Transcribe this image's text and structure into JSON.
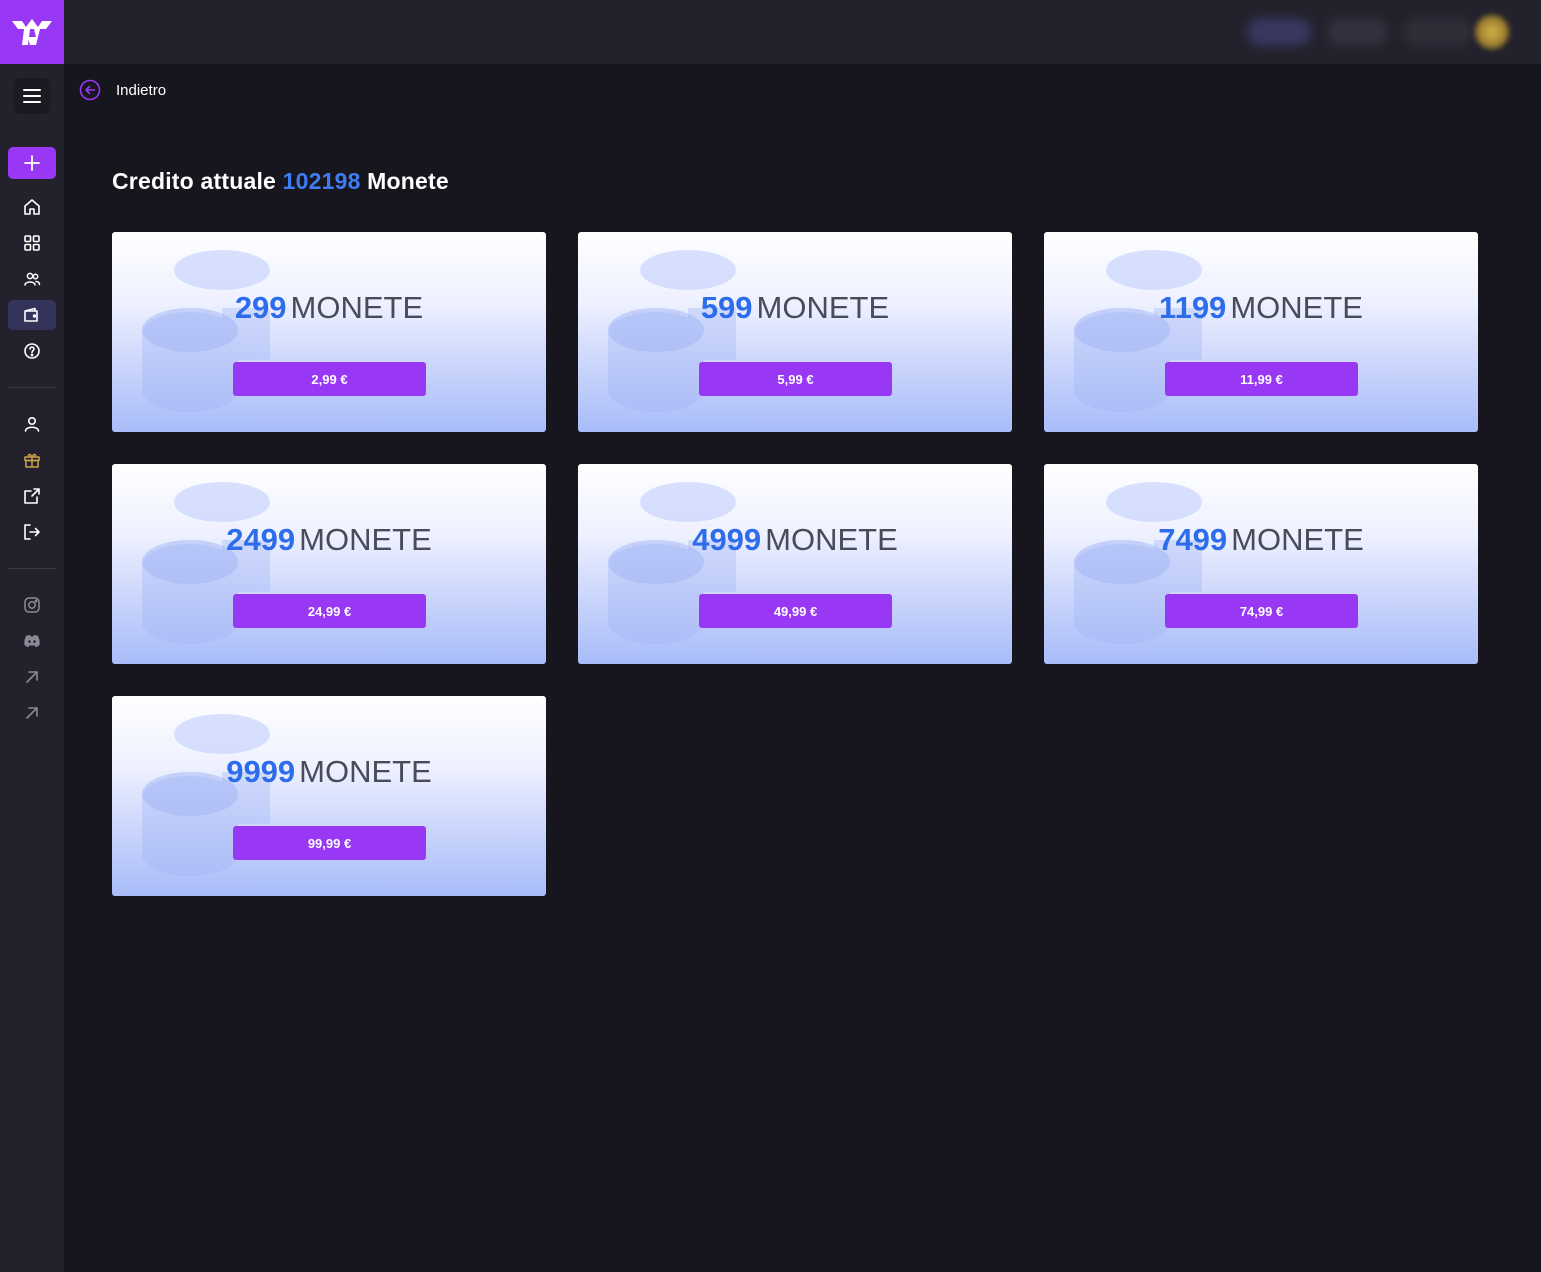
{
  "nav": {
    "back_label": "Indietro"
  },
  "credit": {
    "prefix": "Credito attuale",
    "amount": "102198",
    "suffix": "Monete"
  },
  "packages": [
    {
      "coins": "299",
      "unit": "MONETE",
      "price": "2,99 €"
    },
    {
      "coins": "599",
      "unit": "MONETE",
      "price": "5,99 €"
    },
    {
      "coins": "1199",
      "unit": "MONETE",
      "price": "11,99 €"
    },
    {
      "coins": "2499",
      "unit": "MONETE",
      "price": "24,99 €"
    },
    {
      "coins": "4999",
      "unit": "MONETE",
      "price": "49,99 €"
    },
    {
      "coins": "7499",
      "unit": "MONETE",
      "price": "74,99 €"
    },
    {
      "coins": "9999",
      "unit": "MONETE",
      "price": "99,99 €"
    }
  ],
  "sidebar": {
    "icons": [
      "menu-icon",
      "plus-icon",
      "home-icon",
      "grid-icon",
      "users-icon",
      "wallet-icon",
      "help-icon",
      "user-icon",
      "gift-icon",
      "external-link-icon",
      "logout-icon",
      "instagram-icon",
      "discord-icon",
      "arrow-up-right-icon",
      "arrow-up-right-icon"
    ]
  },
  "colors": {
    "accent": "#9838f5",
    "highlight_blue": "#3d7cf2",
    "background": "#17161e",
    "panel": "#22212c"
  }
}
